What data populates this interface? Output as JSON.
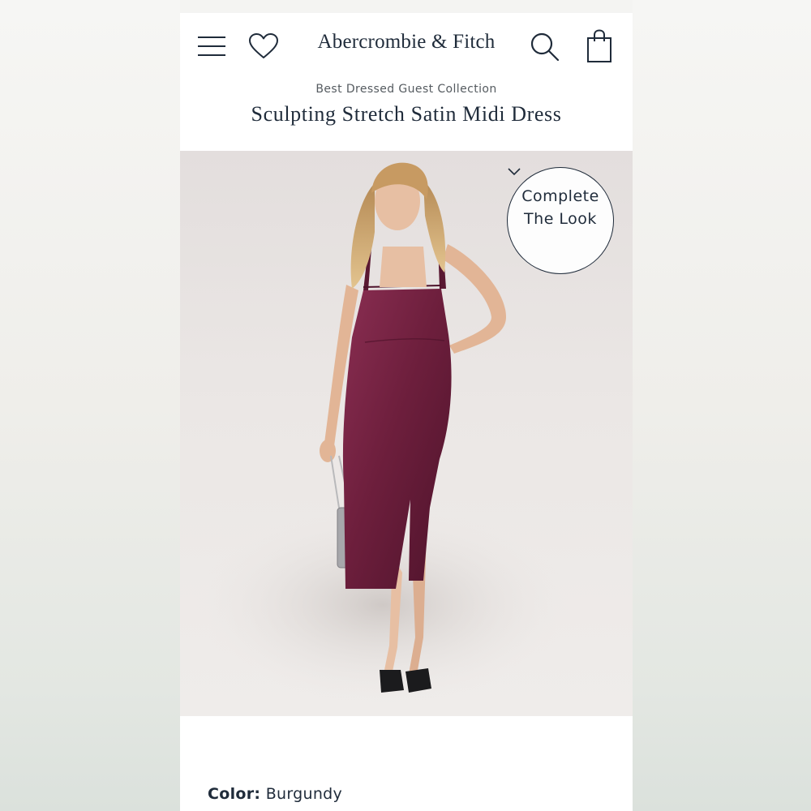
{
  "header": {
    "logo_text": "Abercrombie & Fitch",
    "icons": [
      "menu-icon",
      "heart-icon",
      "search-icon",
      "shopping-bag-icon"
    ]
  },
  "product": {
    "collection": "Best Dressed Guest Collection",
    "title": "Sculpting Stretch Satin Midi Dress",
    "complete_look": {
      "line1": "Complete",
      "line2": "The Look",
      "icon": "chevron-down-icon"
    },
    "color_label": "Color:",
    "color_value": "Burgundy"
  },
  "colors": {
    "brand_navy": "#1f2b3a",
    "dress_burgundy": "#6e1f3d",
    "background": "#ffffff"
  }
}
